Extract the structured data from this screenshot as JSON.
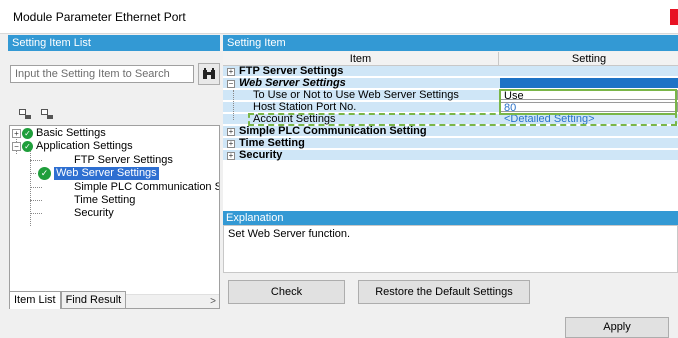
{
  "window": {
    "title": "Module Parameter Ethernet Port"
  },
  "left_panel": {
    "header": "Setting Item List",
    "search_placeholder": "Input the Setting Item to Search",
    "tree": {
      "basic": "Basic Settings",
      "application": "Application Settings",
      "ftp": "FTP Server Settings",
      "web": "Web Server Settings",
      "plc": "Simple PLC Communication Se",
      "time": "Time Setting",
      "security": "Security"
    },
    "tabs": [
      "Item List",
      "Find Result"
    ]
  },
  "right_panel": {
    "header": "Setting Item",
    "columns": {
      "item": "Item",
      "setting": "Setting"
    },
    "rows": {
      "ftp": "FTP Server Settings",
      "web": "Web Server Settings",
      "use": "To Use or Not to Use Web Server Settings",
      "use_val": "Use",
      "port": "Host Station Port No.",
      "port_val": "80",
      "account": "Account Settings",
      "account_val": "<Detailed Setting>",
      "plc": "Simple PLC Communication Setting",
      "time": "Time Setting",
      "security": "Security"
    },
    "explanation": {
      "header": "Explanation",
      "text": "Set Web Server function."
    }
  },
  "buttons": {
    "check": "Check",
    "restore": "Restore the Default Settings",
    "apply": "Apply"
  },
  "colors": {
    "accent": "#3399d4",
    "selection": "#2e6fd1",
    "ok": "#1f9e3b",
    "highlight": "#7ab648"
  }
}
